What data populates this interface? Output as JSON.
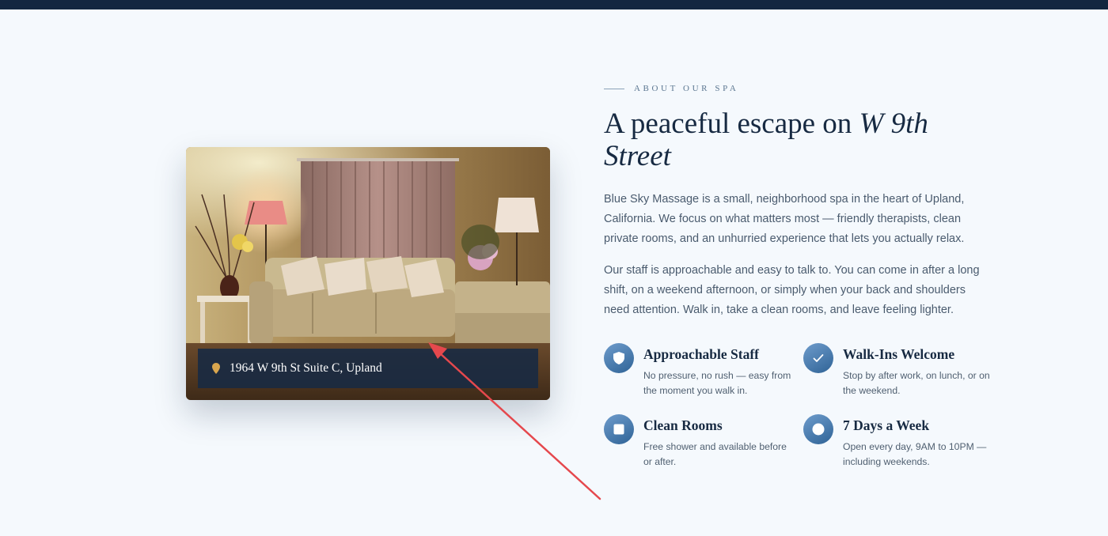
{
  "address": {
    "text": "1964 W 9th St Suite C, Upland",
    "icon": "map-pin-icon"
  },
  "about": {
    "eyebrow": "ABOUT OUR SPA",
    "headline_plain": "A peaceful escape on ",
    "headline_italic": "W 9th Street",
    "paragraph_1": "Blue Sky Massage is a small, neighborhood spa in the heart of Upland, California. We focus on what matters most — friendly therapists, clean private rooms, and an unhurried experience that lets you actually relax.",
    "paragraph_2": "Our staff is approachable and easy to talk to. You can come in after a long shift, on a weekend afternoon, or simply when your back and shoulders need attention. Walk in, take a clean rooms, and leave feeling lighter."
  },
  "features": [
    {
      "title": "Approachable Staff",
      "description": "No pressure, no rush — easy from the moment you walk in.",
      "icon": "shield-icon"
    },
    {
      "title": "Walk-Ins Welcome",
      "description": "Stop by after work, on lunch, or on the weekend.",
      "icon": "checkmark-icon"
    },
    {
      "title": "Clean Rooms",
      "description": "Free shower and available before or after.",
      "icon": "square-icon"
    },
    {
      "title": "7 Days a Week",
      "description": "Open every day, 9AM to 10PM — including weekends.",
      "icon": "circle-icon"
    }
  ],
  "colors": {
    "navy": "#132640",
    "accent_blue": "#3f74a8",
    "pin_gold": "#d9a64e",
    "annotation_red": "#e5484d"
  }
}
